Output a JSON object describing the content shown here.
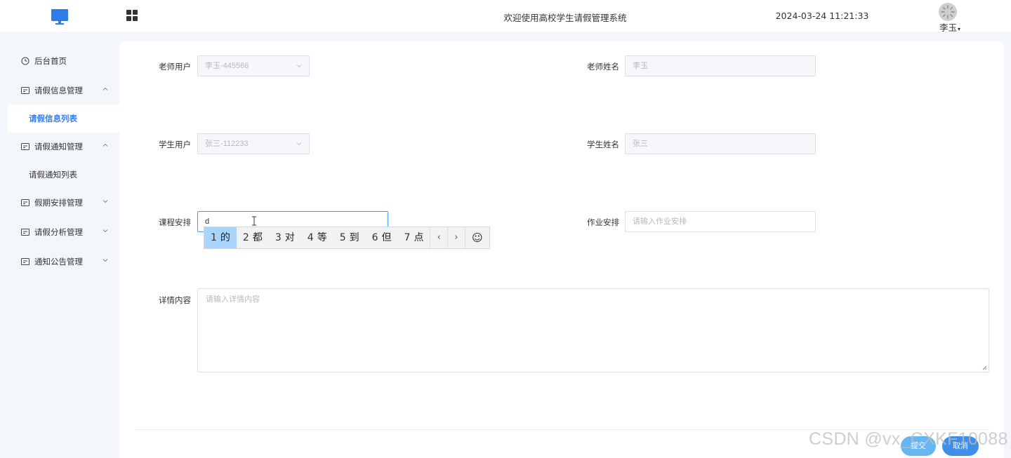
{
  "header": {
    "system_title": "欢迎使用高校学生请假管理系统",
    "datetime": "2024-03-24 11:21:33",
    "user_name": "李玉",
    "user_caret": "▾"
  },
  "sidebar": {
    "items": [
      {
        "label": "后台首页",
        "icon": "clock-icon"
      },
      {
        "label": "请假信息管理",
        "icon": "card-icon",
        "expanded": true
      },
      {
        "label": "请假信息列表",
        "active": true
      },
      {
        "label": "请假通知管理",
        "icon": "card-icon",
        "expanded": true
      },
      {
        "label": "请假通知列表"
      },
      {
        "label": "假期安排管理",
        "icon": "card-icon",
        "expanded": false
      },
      {
        "label": "请假分析管理",
        "icon": "card-icon",
        "expanded": false
      },
      {
        "label": "通知公告管理",
        "icon": "card-icon",
        "expanded": false
      }
    ]
  },
  "form": {
    "teacher_user": {
      "label": "老师用户",
      "value": "李玉-445566"
    },
    "teacher_name": {
      "label": "老师姓名",
      "value": "李玉"
    },
    "student_user": {
      "label": "学生用户",
      "value": "张三-112233"
    },
    "student_name": {
      "label": "学生姓名",
      "value": "张三"
    },
    "course": {
      "label": "课程安排",
      "value": "d"
    },
    "homework": {
      "label": "作业安排",
      "placeholder": "请输入作业安排"
    },
    "detail": {
      "label": "详情内容",
      "placeholder": "请输入详情内容"
    }
  },
  "ime": {
    "candidates": [
      {
        "num": "1",
        "text": "的",
        "selected": true
      },
      {
        "num": "2",
        "text": "都"
      },
      {
        "num": "3",
        "text": "对"
      },
      {
        "num": "4",
        "text": "等"
      },
      {
        "num": "5",
        "text": "到"
      },
      {
        "num": "6",
        "text": "但"
      },
      {
        "num": "7",
        "text": "点"
      }
    ],
    "prev": "‹",
    "next": "›",
    "emoji": "☺"
  },
  "buttons": {
    "submit": "提交",
    "cancel": "取消"
  },
  "watermark": "CSDN @vx_CXKF10088",
  "colors": {
    "accent": "#409eff",
    "active_menu_text": "#3a7ee8",
    "submit_button": "#65b7f3",
    "cancel_button": "#3f8ee7",
    "ime_selected": "#a9d4fb"
  }
}
